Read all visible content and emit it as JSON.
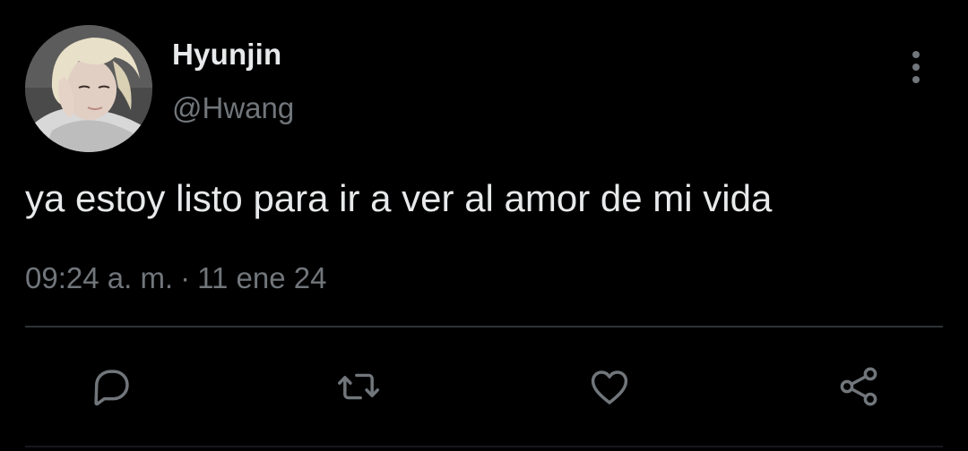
{
  "user": {
    "display_name": "Hyunjin",
    "handle": "@Hwang",
    "avatar_icon": "profile-photo"
  },
  "tweet": {
    "text": "ya estoy listo para ir a ver al amor de mi vida",
    "time": "09:24 a. m.",
    "separator": "·",
    "date": "11 ene 24"
  },
  "actions": {
    "reply_icon": "comment-bubble-icon",
    "retweet_icon": "retweet-arrows-icon",
    "like_icon": "heart-outline-icon",
    "share_icon": "share-nodes-icon",
    "more_icon": "vertical-dots-icon"
  },
  "colors": {
    "background": "#000000",
    "primary_text": "#e7e9ea",
    "secondary_text": "#71767b",
    "divider": "#2f3336",
    "icon": "#71767b"
  }
}
